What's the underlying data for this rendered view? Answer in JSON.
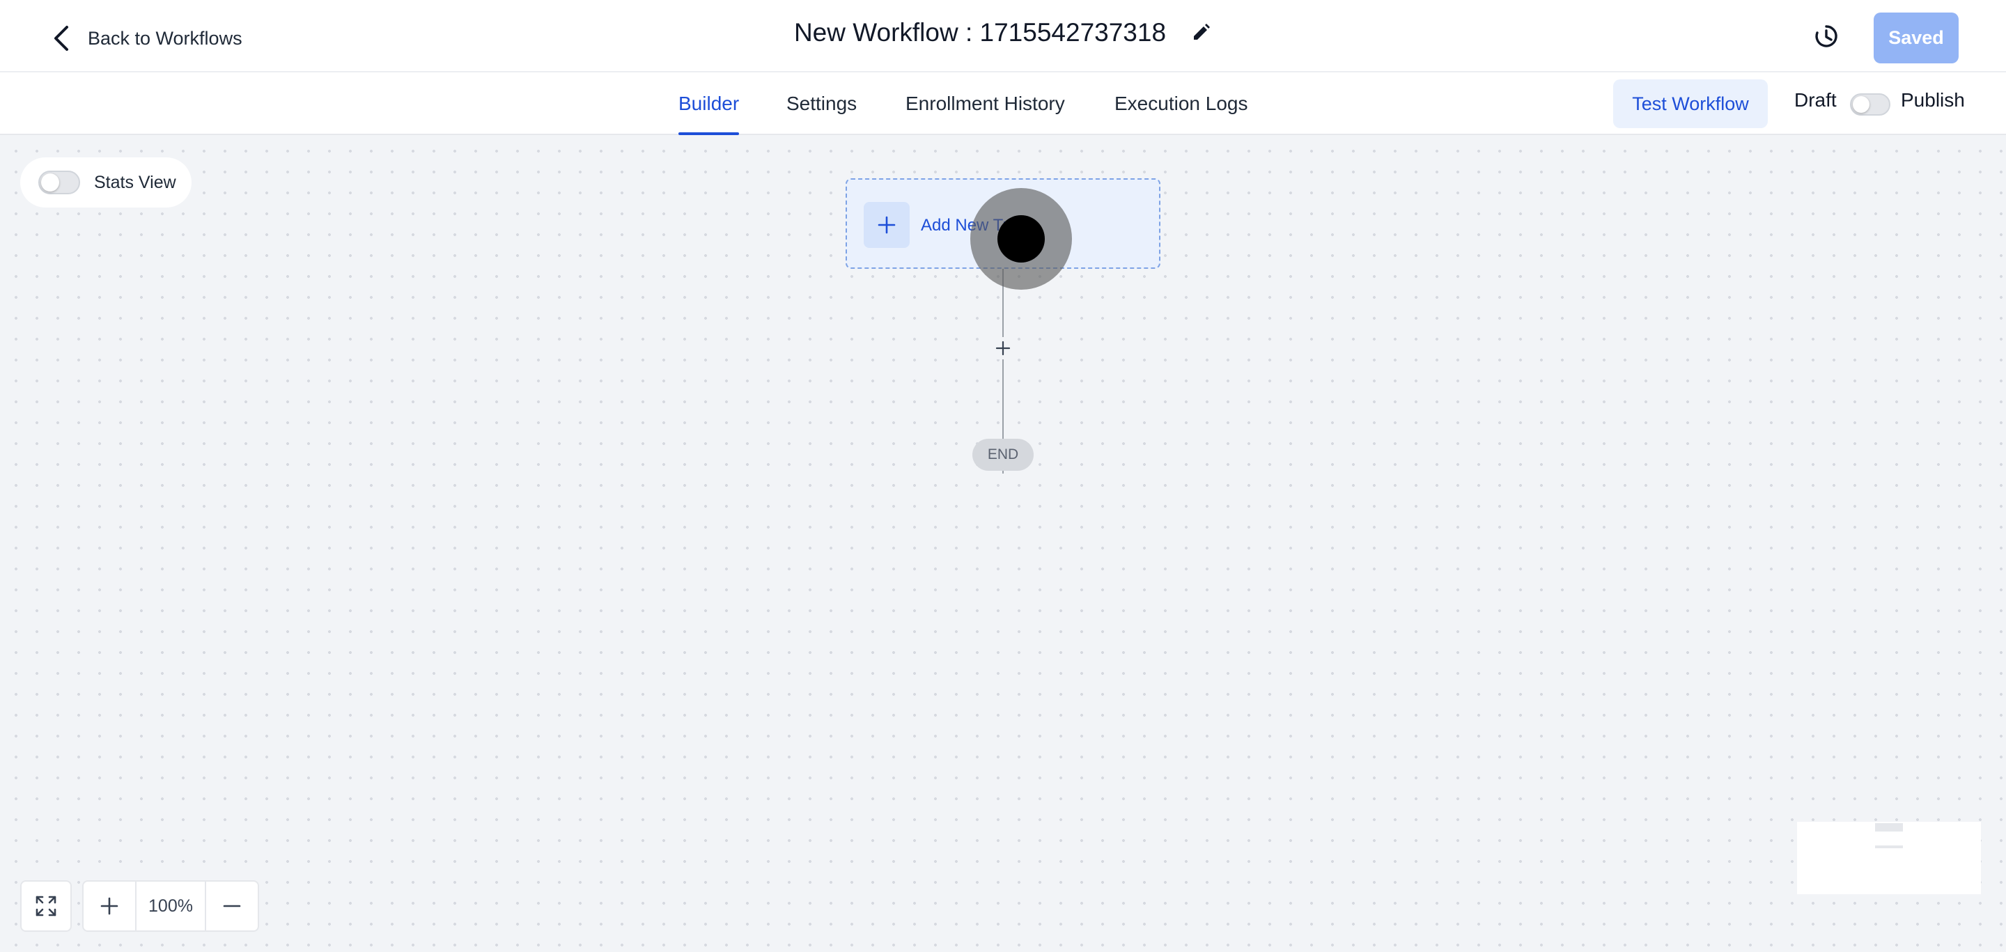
{
  "header": {
    "back_label": "Back to Workflows",
    "workflow_title": "New Workflow : 1715542737318",
    "saved_label": "Saved"
  },
  "tabs": [
    {
      "label": "Builder",
      "active": true
    },
    {
      "label": "Settings",
      "active": false
    },
    {
      "label": "Enrollment History",
      "active": false
    },
    {
      "label": "Execution Logs",
      "active": false
    }
  ],
  "toolbar": {
    "test_workflow_label": "Test Workflow",
    "draft_label": "Draft",
    "publish_label": "Publish",
    "publish_enabled": false
  },
  "canvas": {
    "stats_view_label": "Stats View",
    "stats_view_enabled": false,
    "trigger_label": "Add New Tr",
    "end_label": "END"
  },
  "zoom": {
    "level": "100%"
  },
  "colors": {
    "accent": "#1d4ed8",
    "saved_button": "#93b4f5",
    "canvas_bg": "#f2f4f7",
    "trigger_bg": "#eaf1fd"
  },
  "icons": {
    "back": "chevron-left-icon",
    "edit": "pencil-icon",
    "history": "history-icon",
    "trigger_add": "plus-icon",
    "add_step": "plus-icon",
    "fit": "expand-icon",
    "zoom_in": "plus-icon",
    "zoom_out": "minus-icon"
  }
}
